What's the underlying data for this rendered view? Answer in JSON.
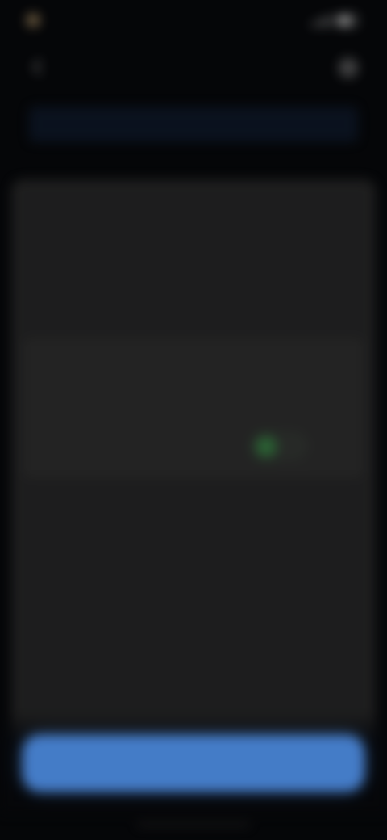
{
  "status_bar": {
    "time": "",
    "signal_icon": "signal-icon",
    "battery_icon": "battery-icon"
  },
  "header": {
    "title": "",
    "back_icon": "arrow-left-icon",
    "more_icon": "more-icon"
  },
  "banner": {
    "text": ""
  },
  "panel": {
    "title": "",
    "label": "",
    "section_heading": "",
    "rows": [
      {
        "label": "",
        "value": ""
      },
      {
        "label": "",
        "toggle_state": "on"
      }
    ]
  },
  "footer": {
    "primary_button_label": ""
  },
  "colors": {
    "background": "#050608",
    "panel": "#202020",
    "accent": "#4a86d8",
    "toggle_on": "#2f6a38",
    "status_accent": "#8a7451"
  }
}
